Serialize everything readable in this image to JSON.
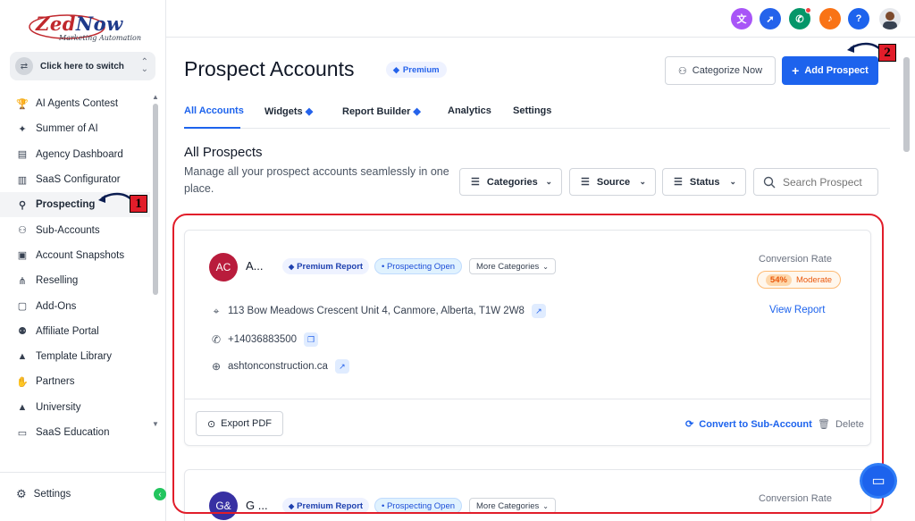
{
  "brand": {
    "logo_main": "Zed",
    "logo_now": "Now",
    "logo_sub": "Marketing Automation"
  },
  "switcher": {
    "label": "Click here to switch"
  },
  "sidebar": {
    "items": [
      {
        "label": "AI Agents Contest",
        "icon": "trophy-icon",
        "glyph": "🏆"
      },
      {
        "label": "Summer of AI",
        "icon": "sparkle-icon",
        "glyph": "✦"
      },
      {
        "label": "Agency Dashboard",
        "icon": "dashboard-icon",
        "glyph": "▤"
      },
      {
        "label": "SaaS Configurator",
        "icon": "bar-chart-icon",
        "glyph": "▥"
      },
      {
        "label": "Prospecting",
        "icon": "users-search-icon",
        "glyph": "⚲",
        "active": true
      },
      {
        "label": "Sub-Accounts",
        "icon": "user-icon",
        "glyph": "⚇"
      },
      {
        "label": "Account Snapshots",
        "icon": "image-icon",
        "glyph": "▣"
      },
      {
        "label": "Reselling",
        "icon": "network-icon",
        "glyph": "⋔"
      },
      {
        "label": "Add-Ons",
        "icon": "bag-icon",
        "glyph": "▢"
      },
      {
        "label": "Affiliate Portal",
        "icon": "group-icon",
        "glyph": "⚉"
      },
      {
        "label": "Template Library",
        "icon": "shapes-icon",
        "glyph": "▲"
      },
      {
        "label": "Partners",
        "icon": "handshake-icon",
        "glyph": "✋"
      },
      {
        "label": "University",
        "icon": "graduation-icon",
        "glyph": "▲"
      },
      {
        "label": "SaaS Education",
        "icon": "book-icon",
        "glyph": "▭"
      }
    ],
    "settings_label": "Settings"
  },
  "topbar": {
    "icons": [
      "translate-icon",
      "rocket-icon",
      "megaphone-icon",
      "bell-icon",
      "help-icon",
      "user-avatar"
    ],
    "colors": {
      "translate": "#a855f7",
      "rocket": "#2563eb",
      "megaphone": "#059669",
      "bell": "#f97316",
      "help": "#1d63ed"
    }
  },
  "page": {
    "title": "Prospect Accounts",
    "premium_badge": "Premium",
    "categorize_label": "Categorize Now",
    "add_label": "Add Prospect"
  },
  "tabs": [
    {
      "label": "All Accounts",
      "active": true
    },
    {
      "label": "Widgets",
      "premium": true
    },
    {
      "label": "Report Builder",
      "premium": true
    },
    {
      "label": "Analytics"
    },
    {
      "label": "Settings"
    }
  ],
  "section": {
    "title": "All Prospects",
    "description": "Manage all your prospect accounts seamlessly in one place."
  },
  "filters": {
    "categories": "Categories",
    "source": "Source",
    "status": "Status",
    "search_placeholder": "Search Prospect"
  },
  "cards": [
    {
      "initials": "AC",
      "avatar_color": "#b91c3c",
      "name": "A...",
      "chip_premium": "Premium Report",
      "chip_status": "• Prospecting Open",
      "chip_more": "More Categories",
      "conversion_label": "Conversion Rate",
      "conversion_pct": "54%",
      "conversion_level": "Moderate",
      "view_report": "View Report",
      "address": "113 Bow Meadows Crescent Unit 4, Canmore, Alberta, T1W 2W8",
      "phone": "+14036883500",
      "website": "ashtonconstruction.ca",
      "export_label": "Export PDF",
      "convert_label": "Convert to Sub-Account",
      "delete_label": "Delete"
    },
    {
      "initials": "G&",
      "avatar_color": "#3730a3",
      "name": "G ...",
      "chip_premium": "Premium Report",
      "chip_status": "• Prospecting Open",
      "chip_more": "More Categories",
      "conversion_label": "Conversion Rate"
    }
  ],
  "annotations": {
    "step1": "1",
    "step2": "2",
    "accent": "#e11d2a"
  }
}
